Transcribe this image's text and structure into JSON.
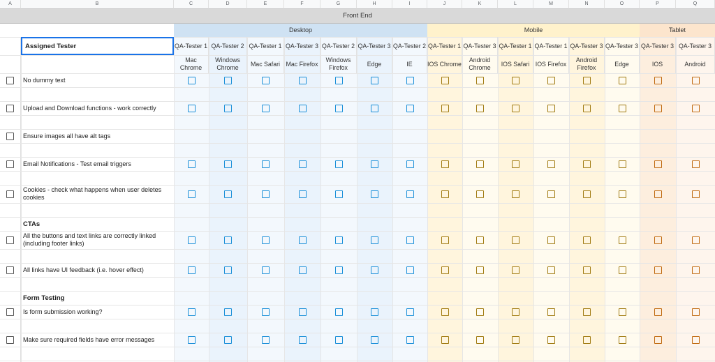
{
  "columns": {
    "letters": [
      "A",
      "B",
      "C",
      "D",
      "E",
      "F",
      "G",
      "H",
      "I",
      "J",
      "K",
      "L",
      "M",
      "N",
      "O",
      "P",
      "Q"
    ]
  },
  "banner": "Front End",
  "groups": [
    {
      "name": "Desktop",
      "color": "#cfe2f3"
    },
    {
      "name": "Mobile",
      "color": "#fff2cc"
    },
    {
      "name": "Tablet",
      "color": "#fce5cd"
    }
  ],
  "assigned_label": "Assigned Tester",
  "testers": [
    {
      "tester": "QA-Tester 1",
      "browser": "Mac Chrome",
      "group": "desktop"
    },
    {
      "tester": "QA-Tester 2",
      "browser": "Windows Chrome",
      "group": "desktop"
    },
    {
      "tester": "QA-Tester 1",
      "browser": "Mac Safari",
      "group": "desktop"
    },
    {
      "tester": "QA-Tester 3",
      "browser": "Mac Firefox",
      "group": "desktop"
    },
    {
      "tester": "QA-Tester 2",
      "browser": "Windows Firefox",
      "group": "desktop"
    },
    {
      "tester": "QA-Tester 3",
      "browser": "Edge",
      "group": "desktop"
    },
    {
      "tester": "QA-Tester 2",
      "browser": "IE",
      "group": "desktop"
    },
    {
      "tester": "QA-Tester 1",
      "browser": "IOS Chrome",
      "group": "mobile"
    },
    {
      "tester": "QA-Tester 3",
      "browser": "Android Chrome",
      "group": "mobile"
    },
    {
      "tester": "QA-Tester 1",
      "browser": "IOS Safari",
      "group": "mobile"
    },
    {
      "tester": "QA-Tester 1",
      "browser": "IOS Firefox",
      "group": "mobile"
    },
    {
      "tester": "QA-Tester 3",
      "browser": "Android Firefox",
      "group": "mobile"
    },
    {
      "tester": "QA-Tester 3",
      "browser": "Edge",
      "group": "mobile"
    },
    {
      "tester": "QA-Tester 3",
      "browser": "IOS",
      "group": "tablet"
    },
    {
      "tester": "QA-Tester 3",
      "browser": "Android",
      "group": "tablet"
    }
  ],
  "rows": [
    {
      "kind": "task",
      "label": "No dummy text"
    },
    {
      "kind": "spacer"
    },
    {
      "kind": "task",
      "label": "Upload and Download functions - work correctly"
    },
    {
      "kind": "spacer"
    },
    {
      "kind": "task-noboxes",
      "label": "Ensure images all have alt tags"
    },
    {
      "kind": "spacer"
    },
    {
      "kind": "task",
      "label": "Email Notifications - Test email triggers"
    },
    {
      "kind": "spacer"
    },
    {
      "kind": "task",
      "label": "Cookies - check what happens when user deletes cookies"
    },
    {
      "kind": "spacer"
    },
    {
      "kind": "section",
      "label": "CTAs"
    },
    {
      "kind": "task",
      "label": "All the buttons and text links are correctly linked (including footer links)"
    },
    {
      "kind": "spacer"
    },
    {
      "kind": "task",
      "label": "All links have UI feedback (i.e. hover effect)"
    },
    {
      "kind": "spacer"
    },
    {
      "kind": "section",
      "label": "Form Testing"
    },
    {
      "kind": "task",
      "label": "Is form submission working?"
    },
    {
      "kind": "spacer"
    },
    {
      "kind": "task",
      "label": "Make sure required fields have error messages"
    },
    {
      "kind": "spacer"
    },
    {
      "kind": "spacer"
    }
  ]
}
